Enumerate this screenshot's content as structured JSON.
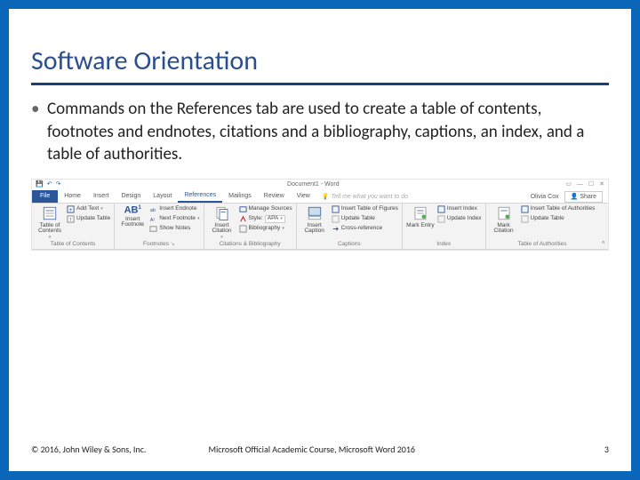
{
  "slide": {
    "title": "Software Orientation",
    "bullet": "Commands on the References tab are used to create a table of contents, footnotes and endnotes, citations and a bibliography, captions, an index, and a table of authorities.",
    "page": "3"
  },
  "footer": {
    "copyright": "© 2016, John Wiley & Sons, Inc.",
    "center": "Microsoft Official Academic Course, Microsoft Word 2016"
  },
  "ribbon": {
    "docname": "Document1 - Word",
    "user": "Olivia Cox",
    "share": "Share",
    "tellme": "Tell me what you want to do",
    "tabs": {
      "file": "File",
      "home": "Home",
      "insert": "Insert",
      "design": "Design",
      "layout": "Layout",
      "references": "References",
      "mailings": "Mailings",
      "review": "Review",
      "view": "View"
    },
    "toc": {
      "main": "Table of Contents",
      "add": "Add Text",
      "update": "Update Table",
      "group": "Table of Contents"
    },
    "fn": {
      "main": "Insert Footnote",
      "ab": "AB",
      "sup": "1",
      "end": "Insert Endnote",
      "next": "Next Footnote",
      "show": "Show Notes",
      "group": "Footnotes"
    },
    "cit": {
      "main": "Insert Citation",
      "manage": "Manage Sources",
      "style_lbl": "Style:",
      "style_val": "APA",
      "bib": "Bibliography",
      "group": "Citations & Bibliography"
    },
    "cap": {
      "main": "Insert Caption",
      "tof": "Insert Table of Figures",
      "update": "Update Table",
      "xref": "Cross-reference",
      "group": "Captions"
    },
    "idx": {
      "main": "Mark Entry",
      "insert": "Insert Index",
      "update": "Update Index",
      "group": "Index"
    },
    "toa": {
      "main": "Mark Citation",
      "insert": "Insert Table of Authorities",
      "update": "Update Table",
      "group": "Table of Authorities"
    }
  }
}
